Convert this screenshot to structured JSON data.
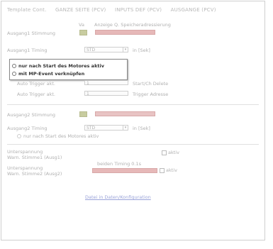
{
  "nav": {
    "tabs": [
      "Template Cont.",
      "GANZE SEITE (PCV)",
      "INPUTS DEF (PCV)",
      "AUSGANGE (PCV)"
    ]
  },
  "section1": {
    "col_label_a": "Va",
    "col_label_b": "Anzeige Q. Speicheradressierung",
    "output1_label": "Ausgang1 Stimmung",
    "output1_timing_label": "Ausgang1 Timing",
    "output1_timing_value": "STD",
    "output1_timing_unit": "in [Sek]",
    "dropdown_options": [
      "nur nach Start des Motores aktiv",
      "mit MP-Event verknüpfen"
    ],
    "auto_trigger1_label": "Auto Trigger akt.",
    "auto_trigger1_value": "1",
    "auto_trigger1_suffix": "Start/Ch Delete",
    "auto_trigger2_label": "Auto Trigger akt.",
    "auto_trigger2_value": "1",
    "auto_trigger2_suffix": "Trigger Adresse"
  },
  "section2": {
    "output2_label": "Ausgang2 Stimmung",
    "output2_timing_label": "Ausgang2 Timing",
    "output2_timing_value": "STD",
    "output2_timing_unit": "in [Sek]",
    "motor_start_label": "nur nach Start des Motores aktiv"
  },
  "section3": {
    "undervoltage1_line1": "Unterspannung",
    "undervoltage1_line2": "Warn. Stimme1 (Ausg1)",
    "undervoltage1_suffix": "aktiv",
    "undervoltage2_line1": "Unterspannung",
    "undervoltage2_line2": "Warn. Stimme2 (Ausg2)",
    "undervoltage2_header": "beiden Timing 0.1s",
    "undervoltage2_suffix": "aktiv",
    "link_text": "Datei in Daten/Konfiguration"
  },
  "colors": {
    "bar_pink": "#e6b8b8",
    "square_olive": "#c8cca0",
    "link": "#9aa3d9"
  }
}
